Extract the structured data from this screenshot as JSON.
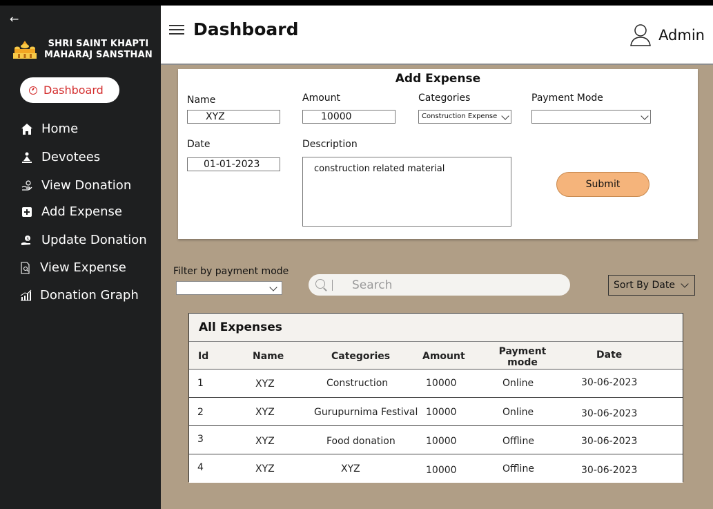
{
  "sidebar": {
    "brand_line1": "SHRI SAINT KHAPTI",
    "brand_line2": "MAHARAJ SANSTHAN",
    "active": "Dashboard",
    "items": [
      {
        "label": "Home",
        "icon": "home-icon"
      },
      {
        "label": "Devotees",
        "icon": "devotees-icon"
      },
      {
        "label": "View Donation",
        "icon": "donation-icon"
      },
      {
        "label": "Add Expense",
        "icon": "plus-square-icon"
      },
      {
        "label": "Update Donation",
        "icon": "money-hand-icon"
      },
      {
        "label": "View Expense",
        "icon": "document-search-icon"
      },
      {
        "label": "Donation Graph",
        "icon": "graph-icon"
      }
    ]
  },
  "header": {
    "title": "Dashboard",
    "user": "Admin"
  },
  "form": {
    "title": "Add Expense",
    "name_label": "Name",
    "name_value": "XYZ",
    "amount_label": "Amount",
    "amount_value": "10000",
    "categories_label": "Categories",
    "categories_value": "Construction Expense",
    "payment_label": "Payment Mode",
    "payment_value": "",
    "date_label": "Date",
    "date_value": "01-01-2023",
    "description_label": "Description",
    "description_value": "construction related material",
    "submit_label": "Submit"
  },
  "filters": {
    "filter_label": "Filter by payment mode",
    "search_placeholder": "Search",
    "sort_label": "Sort By Date"
  },
  "table": {
    "title": "All Expenses",
    "columns": [
      "Id",
      "Name",
      "Categories",
      "Amount",
      "Payment mode",
      "Date"
    ],
    "rows": [
      [
        "1",
        "XYZ",
        "Construction",
        "10000",
        "Online",
        "30-06-2023"
      ],
      [
        "2",
        "XYZ",
        "Gurupurnima Festival",
        "10000",
        "Online",
        "30-06-2023"
      ],
      [
        "3",
        "XYZ",
        "Food donation",
        "10000",
        "Offline",
        "30-06-2023"
      ],
      [
        "4",
        "XYZ",
        "XYZ",
        "10000",
        "Offline",
        "30-06-2023"
      ]
    ]
  },
  "colors": {
    "sidebar": "#1e1f20",
    "main": "#b09e86",
    "accent": "#d32b2b",
    "submit": "#f5b47b"
  }
}
